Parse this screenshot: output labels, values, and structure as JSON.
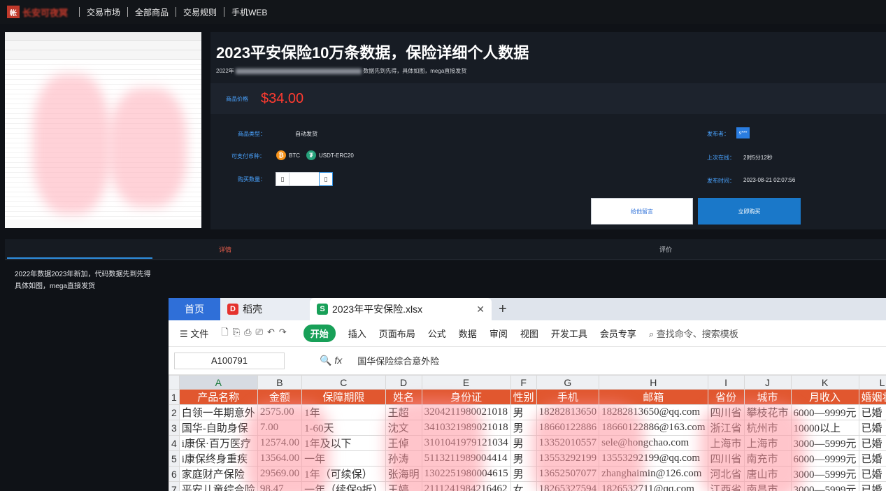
{
  "nav": {
    "logo_badge": "帐",
    "logo_text": "长安可夜冥",
    "links": [
      "交易市场",
      "全部商品",
      "交易规则",
      "手机WEB"
    ]
  },
  "product": {
    "title": "2023平安保险10万条数据，保险详细个人数据",
    "subtitle_visible": "数据先到先得，具体如图，mega直接发货",
    "subtitle_prefix": "2022年",
    "price_label": "商品价格",
    "price": "$34.00",
    "type_label": "商品类型：",
    "type_value": "自动发货",
    "currency_label": "可支付币种：",
    "currencies": [
      {
        "name": "BTC",
        "icon": "bitcoin-icon",
        "color": "#f7931a"
      },
      {
        "name": "USDT-ERC20",
        "icon": "tether-icon",
        "color": "#26a17b"
      }
    ],
    "qty_label": "购买数量：",
    "publisher_label": "发布者：",
    "publisher_value": "s***",
    "last_online_label": "上次在线：",
    "last_online_value": "2时5分12秒",
    "published_label": "发布时间：",
    "published_value": "2023-08-21 02:07:56",
    "message_button": "给他留言",
    "buy_button": "立即购买"
  },
  "tabs": {
    "details": "详情",
    "reviews": "评价"
  },
  "description": {
    "line1": "2022年数据2023年新加，代码数据先到先得",
    "line2": "具体如图，mega直接发货"
  },
  "spreadsheet": {
    "tabs": {
      "home": "首页",
      "app": "稻壳",
      "file": "2023年平安保险.xlsx"
    },
    "menu": [
      "文件",
      "开始",
      "插入",
      "页面布局",
      "公式",
      "数据",
      "审阅",
      "视图",
      "开发工具",
      "会员专享"
    ],
    "search_placeholder": "查找命令、搜索模板",
    "cell_ref": "A100791",
    "fx": "fx",
    "formula_value": "国华保险综合意外险",
    "columns": [
      "A",
      "B",
      "C",
      "D",
      "E",
      "F",
      "G",
      "H",
      "I",
      "J",
      "K",
      "L"
    ],
    "header_row": [
      "产品名称",
      "金额",
      "保障期限",
      "姓名",
      "身份证",
      "性别",
      "手机",
      "邮箱",
      "省份",
      "城市",
      "月收入",
      "婚姻状况"
    ],
    "rows": [
      [
        "2",
        "白领一年期意外",
        "2575.00",
        "1年",
        "王超",
        "3204211980021018",
        "男",
        "18282813650",
        "18282813650@qq.com",
        "四川省",
        "攀枝花市",
        "6000—9999元",
        "已婚"
      ],
      [
        "3",
        "国华-自助身保",
        "7.00",
        "1-60天",
        "沈文",
        "3410321989021018",
        "男",
        "18660122886",
        "18660122886@163.com",
        "浙江省",
        "杭州市",
        "10000以上",
        "已婚"
      ],
      [
        "4",
        "i康保·百万医疗",
        "12574.00",
        "1年及以下",
        "王倬",
        "3101041979121034",
        "男",
        "13352010557",
        "sele@hongchao.com",
        "上海市",
        "上海市",
        "3000—5999元",
        "已婚"
      ],
      [
        "5",
        "i康保终身重疾",
        "13564.00",
        "一年",
        "孙涛",
        "5113211989004414",
        "男",
        "13553292199",
        "13553292199@qq.com",
        "四川省",
        "南充市",
        "6000—9999元",
        "已婚"
      ],
      [
        "6",
        "家庭财产保险",
        "29569.00",
        "1年（可续保）",
        "张海明",
        "1302251980004615",
        "男",
        "13652507077",
        "zhanghaimin@126.com",
        "河北省",
        "唐山市",
        "3000—5999元",
        "已婚"
      ],
      [
        "7",
        "平安儿童综合险",
        "98.47",
        "一年（续保9折）",
        "王婷",
        "2111241984216462",
        "女",
        "18265327594",
        "1826532711@qq.com",
        "江西省",
        "南昌市",
        "3000—5999元",
        "已婚"
      ]
    ]
  },
  "colors": {
    "accent_blue": "#1a78c9",
    "price_red": "#ff3b30",
    "label_blue": "#4aa3ff",
    "sheet_header": "#e1572f",
    "wps_green": "#18a058"
  }
}
